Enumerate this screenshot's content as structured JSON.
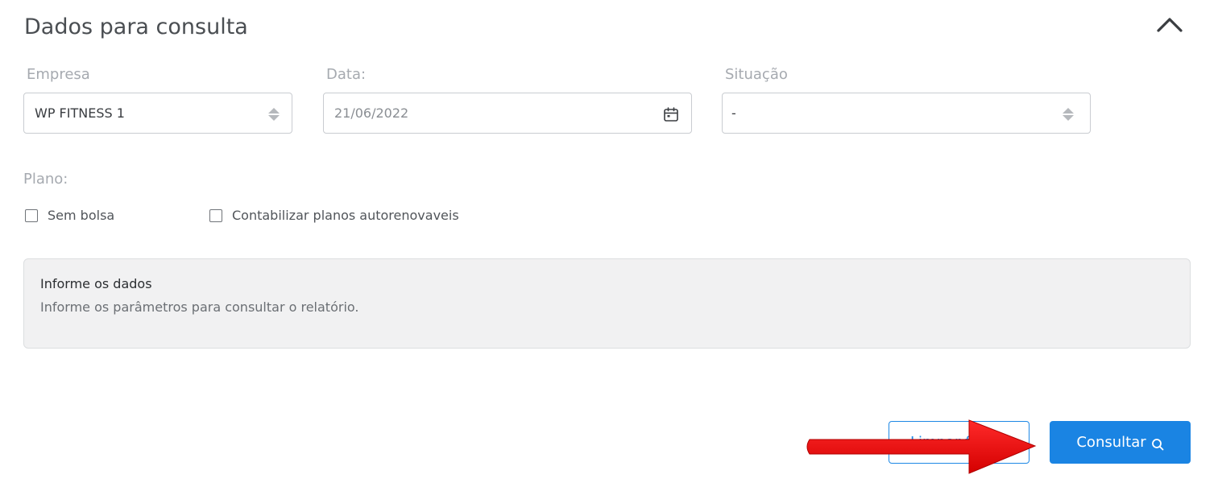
{
  "panel": {
    "title": "Dados para consulta"
  },
  "filters": {
    "empresa": {
      "label": "Empresa",
      "value": "WP FITNESS 1"
    },
    "data": {
      "label": "Data:",
      "value": "21/06/2022"
    },
    "situacao": {
      "label": "Situação",
      "value": "-"
    },
    "plano": {
      "label": "Plano:",
      "options": [
        {
          "label": "Sem bolsa",
          "checked": false
        },
        {
          "label": "Contabilizar planos autorenovaveis",
          "checked": false
        }
      ]
    }
  },
  "info": {
    "title": "Informe os dados",
    "text": "Informe os parâmetros para consultar o relatório."
  },
  "actions": {
    "clear_label": "Limpar filtros",
    "search_label": "Consultar"
  },
  "colors": {
    "primary": "#1a84e3",
    "annotation_arrow": "#e01010"
  },
  "icons": {
    "collapse": "chevron-up-icon",
    "select": "sort-arrows-icon",
    "date": "calendar-icon",
    "search": "search-icon",
    "annotation": "red-arrow-icon"
  }
}
